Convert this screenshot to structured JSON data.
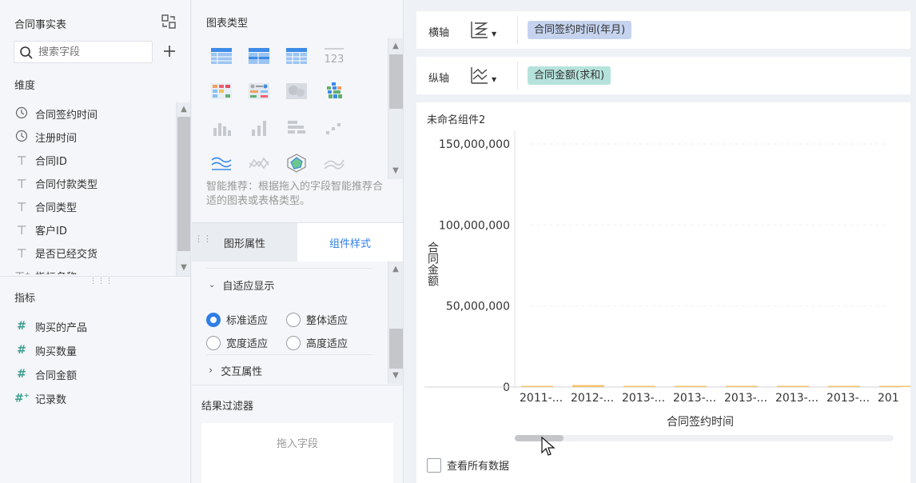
{
  "left": {
    "table_title": "合同事实表",
    "search_placeholder": "搜索字段",
    "dimensions_label": "维度",
    "dimensions": [
      {
        "label": "合同签约时间",
        "type": "time"
      },
      {
        "label": "注册时间",
        "type": "time"
      },
      {
        "label": "合同ID",
        "type": "text"
      },
      {
        "label": "合同付款类型",
        "type": "text"
      },
      {
        "label": "合同类型",
        "type": "text"
      },
      {
        "label": "客户ID",
        "type": "text"
      },
      {
        "label": "是否已经交货",
        "type": "text"
      },
      {
        "label": "指标名称",
        "type": "text-calc"
      }
    ],
    "metrics_label": "指标",
    "metrics": [
      {
        "label": "购买的产品"
      },
      {
        "label": "购买数量"
      },
      {
        "label": "合同金额"
      },
      {
        "label": "记录数"
      }
    ]
  },
  "mid": {
    "chart_types_label": "图表类型",
    "smart_hint": "智能推荐：根据拖入的字段智能推荐合适的图表或表格类型。",
    "tab_shape": "图形属性",
    "tab_style": "组件样式",
    "adaptive_label": "自适应显示",
    "radio_standard": "标准适应",
    "radio_whole": "整体适应",
    "radio_width": "宽度适应",
    "radio_height": "高度适应",
    "interaction_label": "交互属性",
    "filter_label": "结果过滤器",
    "drop_hint": "拖入字段"
  },
  "right": {
    "x_axis_label": "横轴",
    "x_axis_field": "合同签约时间(年月)",
    "y_axis_label": "纵轴",
    "y_axis_field": "合同金额(求和)",
    "widget_title": "未命名组件2",
    "view_all_label": "查看所有数据"
  },
  "colors": {
    "accent": "#2f7ee6",
    "dim_pill": "#c5d3ee",
    "metric_pill": "#b5e3dc",
    "bar": "#f5c26b"
  },
  "chart_data": {
    "type": "bar",
    "ylabel": "合同金额",
    "xlabel": "合同签约时间",
    "yticks": [
      "150,000,000",
      "100,000,000",
      "50,000,000",
      "0"
    ],
    "ylim": [
      0,
      150000000
    ],
    "categories": [
      "2011-...",
      "2012-...",
      "2013-...",
      "2013-...",
      "2013-...",
      "2013-...",
      "2013-...",
      "201"
    ],
    "values": [
      300000,
      1200000,
      200000,
      200000,
      200000,
      200000,
      200000,
      200000
    ],
    "grid": true
  }
}
